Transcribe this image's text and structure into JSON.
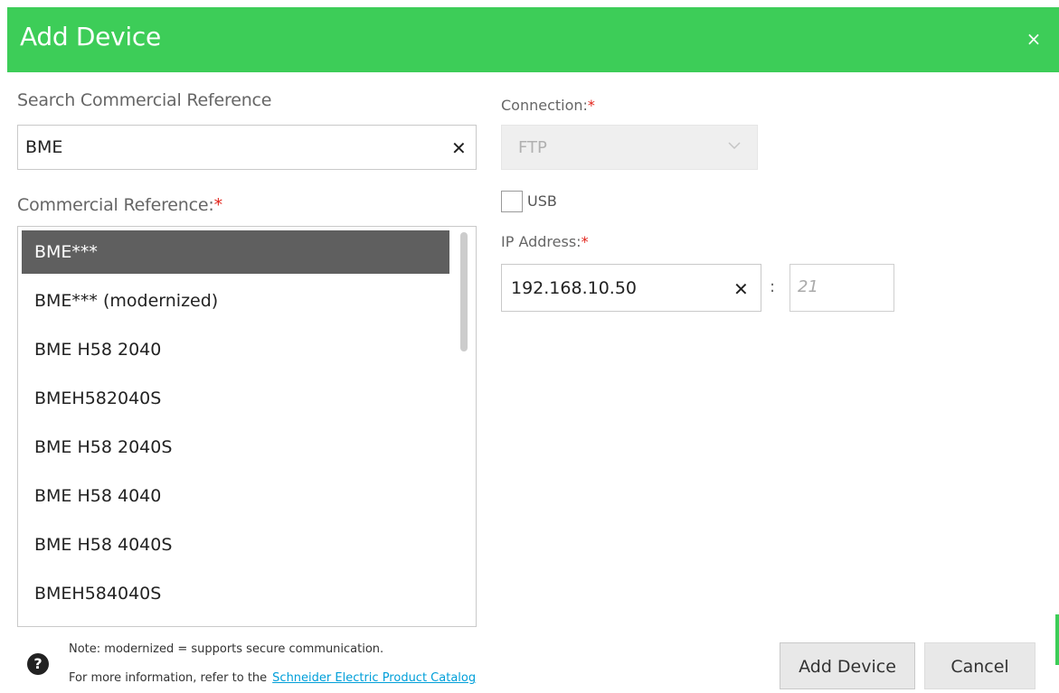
{
  "dialog": {
    "title": "Add Device",
    "close_glyph": "×"
  },
  "search": {
    "label": "Search Commercial Reference",
    "value": "BME",
    "clear_glyph": "✕"
  },
  "commercial_reference": {
    "label": "Commercial Reference:",
    "required_mark": "*",
    "items": [
      {
        "label": "BME***",
        "selected": true
      },
      {
        "label": "BME*** (modernized)",
        "selected": false
      },
      {
        "label": "BME H58 2040",
        "selected": false
      },
      {
        "label": "BMEH582040S",
        "selected": false
      },
      {
        "label": "BME H58 2040S",
        "selected": false
      },
      {
        "label": "BME H58 4040",
        "selected": false
      },
      {
        "label": "BME H58 4040S",
        "selected": false
      },
      {
        "label": "BMEH584040S",
        "selected": false
      }
    ]
  },
  "connection": {
    "label": "Connection:",
    "required_mark": "*",
    "value": "FTP",
    "disabled": true
  },
  "usb": {
    "label": "USB",
    "checked": false
  },
  "ip": {
    "label": "IP Address:",
    "required_mark": "*",
    "value": "192.168.10.50",
    "clear_glyph": "✕",
    "separator": ":",
    "port_placeholder": "21"
  },
  "footer": {
    "help_glyph": "?",
    "note_line1": "Note: modernized = supports secure communication.",
    "note_line2": "For more information, refer to the",
    "link_text": "Schneider Electric Product Catalog"
  },
  "buttons": {
    "add_label": "Add Device",
    "cancel_label": "Cancel"
  },
  "colors": {
    "brand_green": "#3dcd58",
    "required_red": "#e2231a",
    "link_blue": "#009fd9",
    "selected_item_bg": "#5f5f5f"
  }
}
